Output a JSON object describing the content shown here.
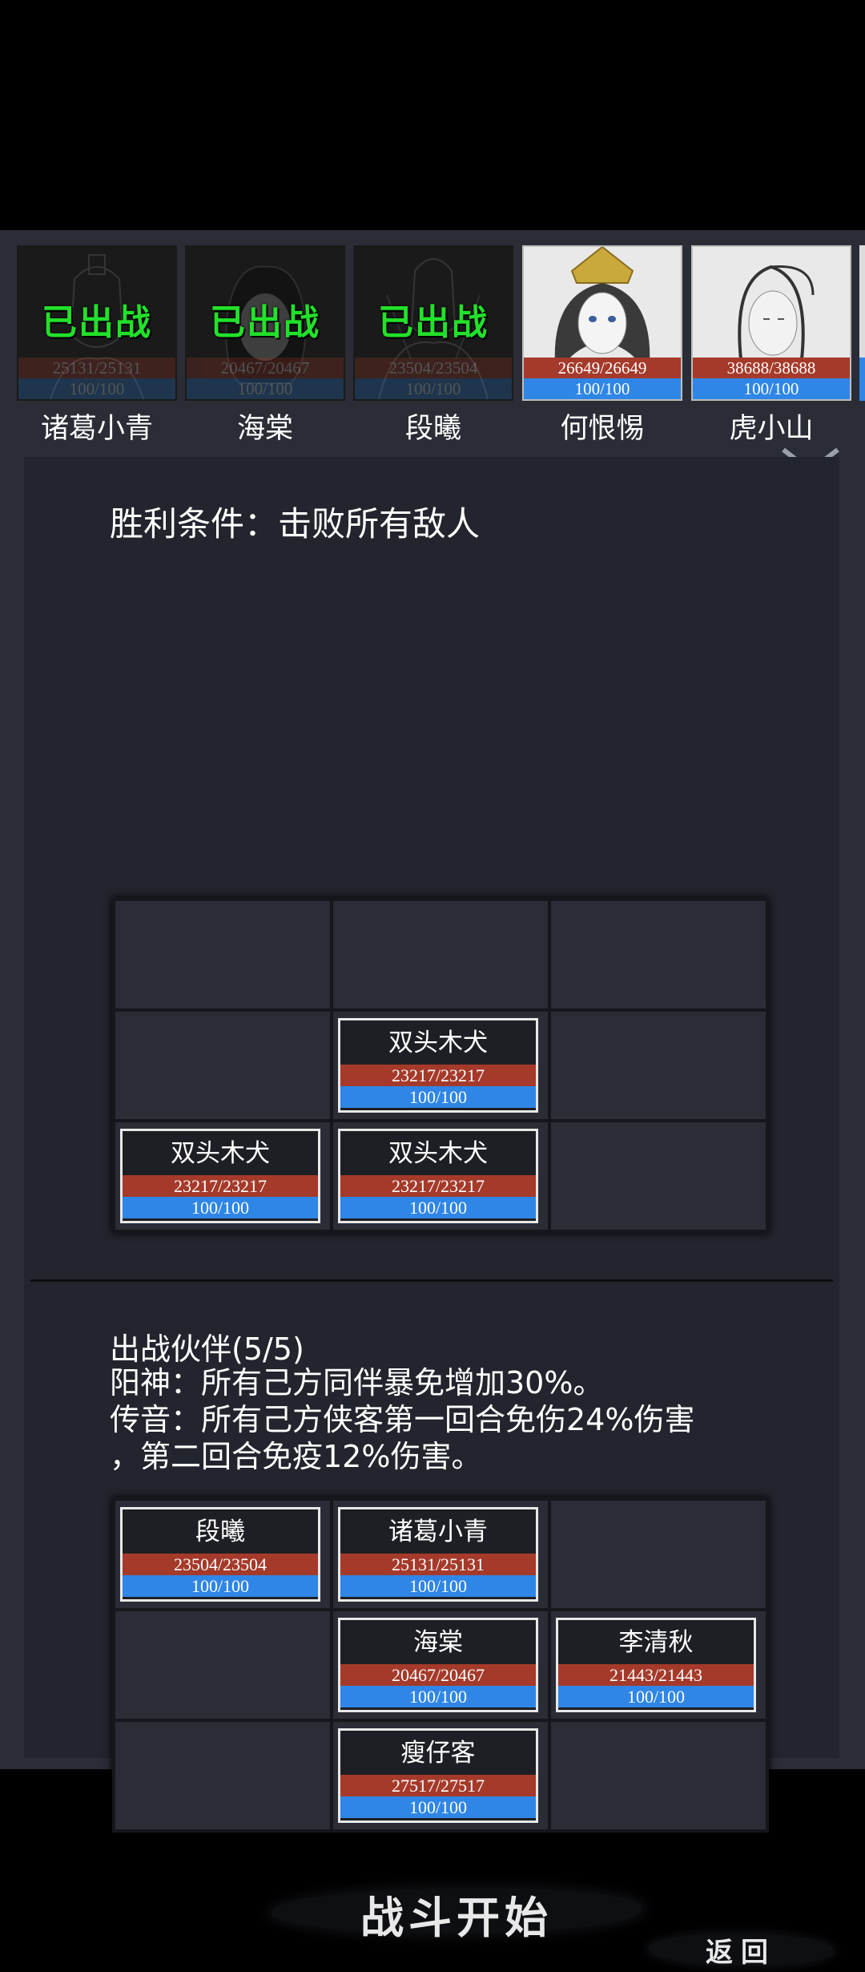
{
  "roster": [
    {
      "name": "诸葛小青",
      "status": "已出战",
      "hp": "25131/25131",
      "mp": "100/100",
      "deployed": true
    },
    {
      "name": "海棠",
      "status": "已出战",
      "hp": "20467/20467",
      "mp": "100/100",
      "deployed": true
    },
    {
      "name": "段曦",
      "status": "已出战",
      "hp": "23504/23504",
      "mp": "100/100",
      "deployed": true
    },
    {
      "name": "何恨惕",
      "status": "",
      "hp": "26649/26649",
      "mp": "100/100",
      "deployed": false
    },
    {
      "name": "虎小山",
      "status": "",
      "hp": "38688/38688",
      "mp": "100/100",
      "deployed": false
    }
  ],
  "victory": "胜利条件：击败所有敌人",
  "enemies": [
    {
      "name": "双头木犬",
      "hp": "23217/23217",
      "mp": "100/100"
    },
    {
      "name": "双头木犬",
      "hp": "23217/23217",
      "mp": "100/100"
    },
    {
      "name": "双头木犬",
      "hp": "23217/23217",
      "mp": "100/100"
    }
  ],
  "team": {
    "title": "出战伙伴(5/5)",
    "buffs": [
      "阳神：所有己方同伴暴免增加30%。",
      "传音：所有己方侠客第一回合免伤24%伤害",
      "，第二回合免疫12%伤害。"
    ],
    "members": [
      {
        "name": "段曦",
        "hp": "23504/23504",
        "mp": "100/100"
      },
      {
        "name": "诸葛小青",
        "hp": "25131/25131",
        "mp": "100/100"
      },
      {
        "name": "海棠",
        "hp": "20467/20467",
        "mp": "100/100"
      },
      {
        "name": "李清秋",
        "hp": "21443/21443",
        "mp": "100/100"
      },
      {
        "name": "瘦仔客",
        "hp": "27517/27517",
        "mp": "100/100"
      }
    ]
  },
  "buttons": {
    "start": "战斗开始",
    "back": "返回"
  },
  "colors": {
    "hp": "#a53a2a",
    "mp": "#2f86e6",
    "deployed_text": "#22e12a",
    "background": "#2a2d35"
  }
}
